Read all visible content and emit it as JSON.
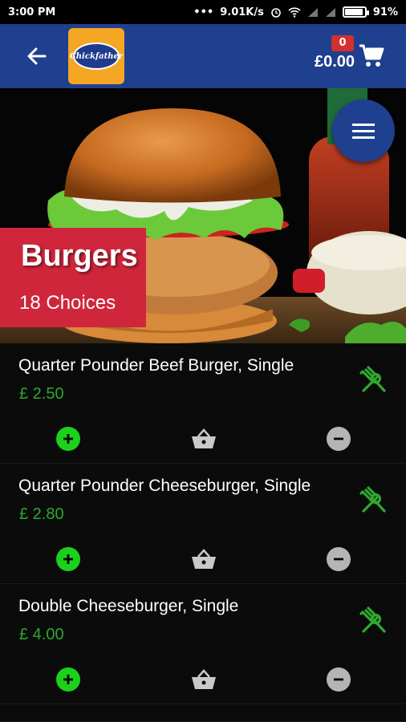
{
  "status_bar": {
    "time": "3:00 PM",
    "network_speed": "9.01K/s",
    "battery": "91%",
    "battery_level": 0.91
  },
  "header": {
    "back_icon": "back-arrow-icon",
    "logo_text": "Chickfather",
    "cart_count": "0",
    "cart_total": "£0.00",
    "cart_icon": "cart-icon"
  },
  "hero": {
    "menu_icon": "hamburger-menu-icon",
    "category_title": "Burgers",
    "category_count": "18 Choices"
  },
  "items": [
    {
      "name": "Quarter Pounder Beef Burger, Single",
      "price": "£ 2.50"
    },
    {
      "name": "Quarter Pounder Cheeseburger, Single",
      "price": "£ 2.80"
    },
    {
      "name": "Double Cheeseburger, Single",
      "price": "£ 4.00"
    }
  ],
  "colors": {
    "header_bg": "#1f3f8f",
    "accent_red": "#d0263c",
    "price_green": "#2ea82e",
    "add_green": "#1bd11b",
    "remove_grey": "#b5b5b5"
  }
}
